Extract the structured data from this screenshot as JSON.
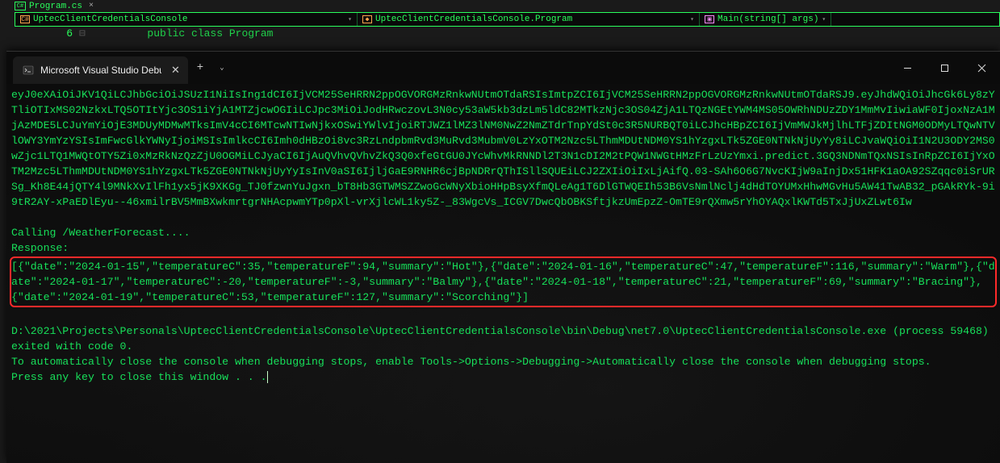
{
  "ide": {
    "tab_file": "Program.cs",
    "breadcrumb": {
      "project": "UptecClientCredentialsConsole",
      "class": "UptecClientCredentialsConsole.Program",
      "method": "Main(string[] args)"
    },
    "line_number": "6",
    "code_line": "public class Program"
  },
  "terminal": {
    "tab_title": "Microsoft Visual Studio Debu",
    "tab_close": "✕",
    "new_tab": "+",
    "dropdown": "⌄",
    "win": {
      "min": "─",
      "max": "□",
      "close": "✕"
    }
  },
  "console": {
    "token_blob": "eyJ0eXAiOiJKV1QiLCJhbGciOiJSUzI1NiIsIng1dCI6IjVCM25SeHRRN2ppOGVORGMzRnkwNUtmOTdaRSIsImtpZCI6IjVCM25SeHRRN2ppOGVORGMzRnkwNUtmOTdaRSJ9.eyJhdWQiOiJhcGk6Ly8zYTliOTIxMS02NzkxLTQ5OTItYjc3OS1iYjA1MTZjcwOGIiLCJpc3MiOiJodHRwczovL3N0cy53aW5kb3dzLm5ldC82MTkzNjc3OS04ZjA1LTQzNGEtYWM4MS05OWRhNDUzZDY1MmMvIiwiaWF0IjoxNzA1MjAzMDE5LCJuYmYiOjE3MDUyMDMwMTksImV4cCI6MTcwNTIwNjkxOSwiYWlvIjoiRTJWZ1lMZ3lNM0NwZ2NmZTdrTnpYdSt0c3R5NURBQT0iLCJhcHBpZCI6IjVmMWJkMjlhLTFjZDItNGM0ODMyLTQwNTVlOWY3YmYzYSIsImFwcGlkYWNyIjoiMSIsImlkcCI6Imh0dHBzOi8vc3RzLndpbmRvd3MuRvd3MubmV0LzYxOTM2Nzc5LThmMDUtNDM0YS1hYzgxLTk5ZGE0NTNkNjUyYy8iLCJvaWQiOiI1N2U3ODY2MS0wZjc1LTQ1MWQtOTY5Zi0xMzRkNzQzZjU0OGMiLCJyaCI6IjAuQVhvQVhvZkQ3Q0xfeGtGU0JYcWhvMkRNNDl2T3N1cDI2M2tPQW1NWGtHMzFrLzUzYmxi.predict.3GQ3NDNmTQxNSIsInRpZCI6IjYxOTM2Mzc5LThmMDUtNDM0YS1hYzgxLTk5ZGE0NTNkNjUyYyIsInV0aSI6IjljGaE9RNHR6cjBpNDRrQThISllSQUEiLCJ2ZXIiOiIxLjAifQ.03-SAh6O6G7NvcKIjW9aInjDx51HFK1aOA92SZqqc0iSrURSg_Kh8E44jQTY4l9MNkXvIlFh1yx5jK9XKGg_TJ0fzwnYuJgxn_bT8Hb3GTWMSZZwoGcWNyXbioHHpBsyXfmQLeAg1T6DlGTWQEIh53B6VsNmlNclj4dHdTOYUMxHhwMGvHu5AW41TwAB32_pGAkRYk-9i9tR2AY-xPaEDlEyu--46xmilrBV5MmBXwkmrtgrNHAcpwmYTp0pXl-vrXjlcWL1ky5Z-_83WgcVs_ICGV7DwcQbOBKSftjkzUmEpzZ-OmTE9rQXmw5rYhOYAQxlKWTd5TxJjUxZLwt6Iw",
    "calling": "Calling /WeatherForecast....",
    "response_label": "Response:",
    "response_body": "[{\"date\":\"2024-01-15\",\"temperatureC\":35,\"temperatureF\":94,\"summary\":\"Hot\"},{\"date\":\"2024-01-16\",\"temperatureC\":47,\"temperatureF\":116,\"summary\":\"Warm\"},{\"date\":\"2024-01-17\",\"temperatureC\":-20,\"temperatureF\":-3,\"summary\":\"Balmy\"},{\"date\":\"2024-01-18\",\"temperatureC\":21,\"temperatureF\":69,\"summary\":\"Bracing\"},{\"date\":\"2024-01-19\",\"temperatureC\":53,\"temperatureF\":127,\"summary\":\"Scorching\"}]",
    "exit_line": "D:\\2021\\Projects\\Personals\\UptecClientCredentialsConsole\\UptecClientCredentialsConsole\\bin\\Debug\\net7.0\\UptecClientCredentialsConsole.exe (process 59468) exited with code 0.",
    "autoclose_hint": "To automatically close the console when debugging stops, enable Tools->Options->Debugging->Automatically close the console when debugging stops.",
    "press_key": "Press any key to close this window . . ."
  }
}
